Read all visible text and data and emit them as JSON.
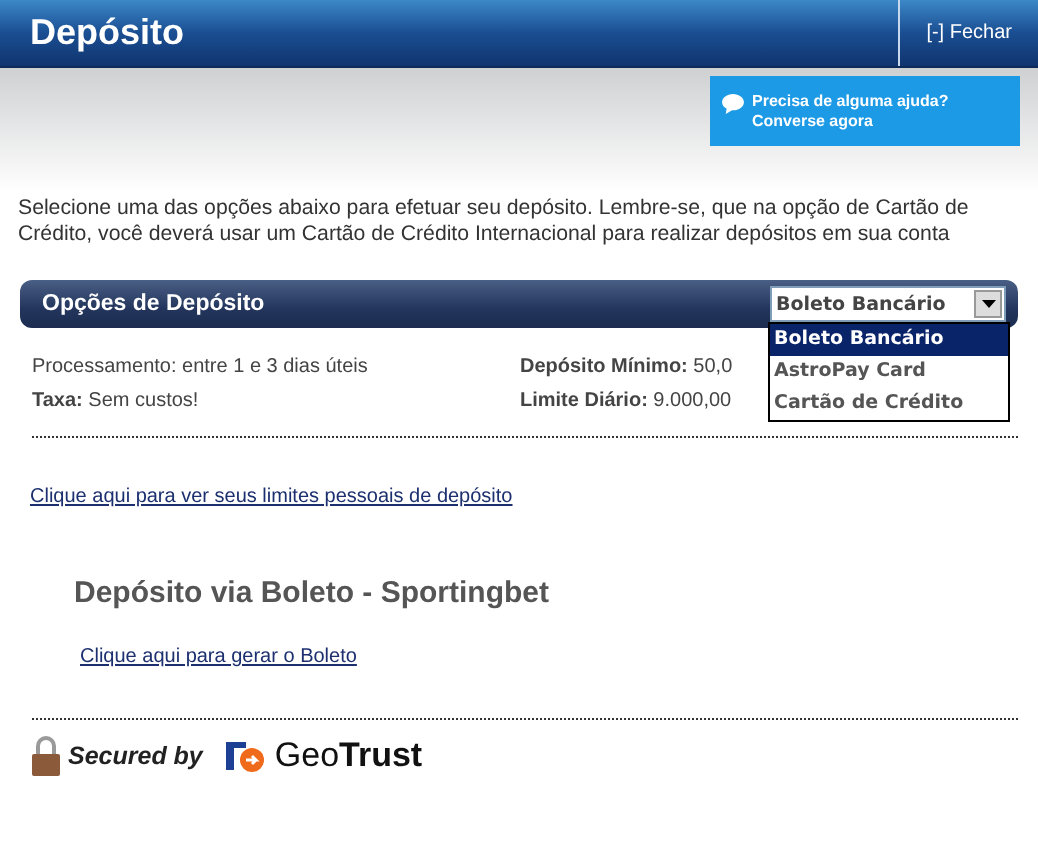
{
  "window": {
    "title": "Depósito",
    "close": "[-] Fechar"
  },
  "help": {
    "line1": "Precisa de alguma ajuda?",
    "line2": "Converse agora"
  },
  "intro": "Selecione uma das opções abaixo para efetuar seu depósito. Lembre-se, que na opção de Cartão de Crédito, você deverá usar um Cartão de Crédito Internacional para realizar depósitos em sua conta",
  "options_panel": {
    "title": "Opções de Depósito",
    "select": {
      "value": "Boleto Bancário",
      "expanded": true,
      "options": [
        {
          "label": "Boleto Bancário",
          "selected": true
        },
        {
          "label": "AstroPay Card",
          "selected": false
        },
        {
          "label": "Cartão de Crédito",
          "selected": false
        }
      ]
    }
  },
  "info": [
    [
      "Processamento: entre 1 e 3 dias úteis",
      "**Depósito Mínimo:** 50,0"
    ],
    [
      "**Taxa:** Sem custos!",
      "**Limite Diário:** 9.000,00"
    ]
  ],
  "limits_link": "Clique aqui para ver seus limites pessoais de depósito",
  "method": {
    "heading": "Depósito via Boleto - Sportingbet",
    "link": "Clique aqui para gerar o Boleto"
  },
  "footer": {
    "secured": "Secured by",
    "brand_light": "Geo",
    "brand_bold": "Trust"
  }
}
